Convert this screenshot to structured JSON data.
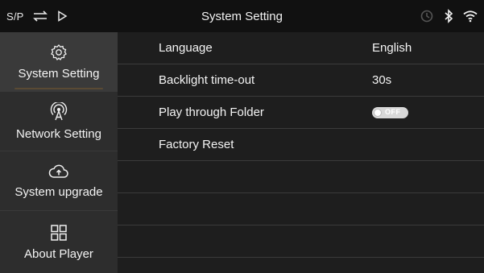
{
  "statusbar": {
    "sp_label": "S/P",
    "title": "System Setting",
    "left_icons": [
      "swap-icon",
      "play-icon"
    ],
    "right_icons": [
      "sync-icon",
      "bluetooth-icon",
      "wifi-icon"
    ]
  },
  "sidebar": {
    "items": [
      {
        "label": "System Setting",
        "icon": "gear-icon",
        "active": true
      },
      {
        "label": "Network Setting",
        "icon": "antenna-icon",
        "active": false
      },
      {
        "label": "System upgrade",
        "icon": "cloud-upload-icon",
        "active": false
      },
      {
        "label": "About Player",
        "icon": "grid-icon",
        "active": false
      }
    ]
  },
  "settings": {
    "rows": [
      {
        "label": "Language",
        "value": "English"
      },
      {
        "label": "Backlight time-out",
        "value": "30s"
      },
      {
        "label": "Play through Folder",
        "toggle": "OFF"
      },
      {
        "label": "Factory Reset",
        "value": ""
      }
    ]
  },
  "colors": {
    "background": "#1e1e1e",
    "statusbar": "#111111",
    "sidebar_item": "#2d2d2d",
    "sidebar_active": "#3a3a3a",
    "divider": "#3b3b3b",
    "toggle_off": "#d8d8d8"
  }
}
